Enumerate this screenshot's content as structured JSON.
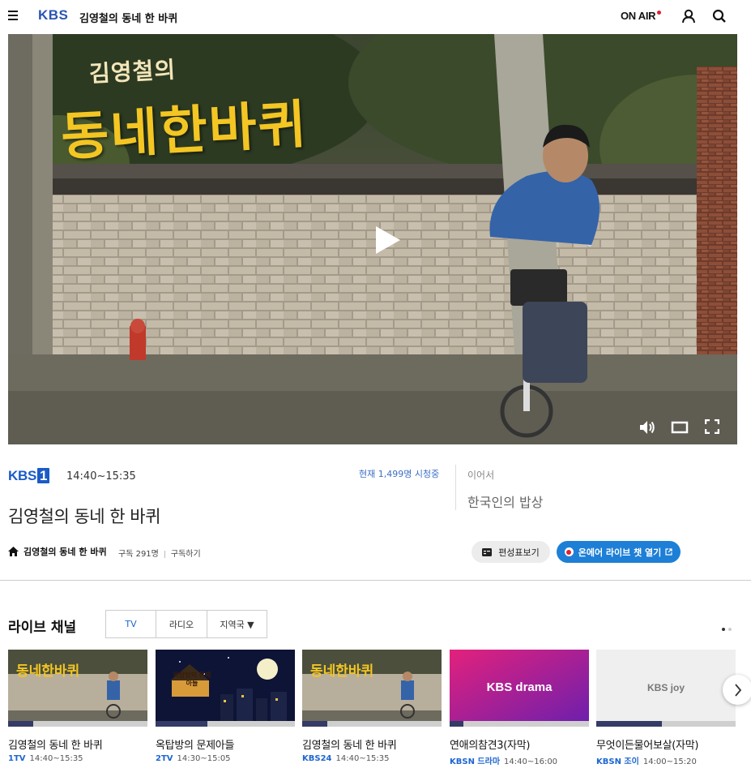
{
  "header": {
    "logo": "KBS",
    "title": "김영철의 동네 한 바퀴",
    "onair": "ON AIR"
  },
  "player": {
    "poster_text_small": "김영철의",
    "poster_text_large": "동네한바퀴"
  },
  "program": {
    "channel_logo": "KBS",
    "channel_logo_num": "1",
    "time": "14:40~15:35",
    "viewers": "현재 1,499명 시청중",
    "next_label": "이어서",
    "next_show": "한국인의 밥상",
    "title": "김영철의 동네 한 바퀴",
    "home_link": "김영철의 동네 한 바퀴",
    "subscribers": "구독 291명",
    "subscribe": "구독하기",
    "schedule_button": "편성표보기",
    "chat_button": "온에어 라이브 챗 열기"
  },
  "live": {
    "heading": "라이브 채널",
    "tabs": [
      "TV",
      "라디오",
      "지역국 ▼"
    ],
    "cards": [
      {
        "title": "김영철의 동네 한 바퀴",
        "channel": "1TV",
        "time": "14:40~15:35",
        "progress": 0.18
      },
      {
        "title": "옥탑방의 문제아들",
        "channel": "2TV",
        "time": "14:30~15:05",
        "progress": 0.37,
        "thumb_text": "옥탑방의 문제아들"
      },
      {
        "title": "김영철의 동네 한 바퀴",
        "channel": "KBS24",
        "time": "14:40~15:35",
        "progress": 0.18
      },
      {
        "title": "연애의참견3(자막)",
        "channel": "KBSN 드라마",
        "time": "14:40~16:00",
        "progress": 0.1,
        "thumb_text": "KBS drama"
      },
      {
        "title": "무엇이든물어보살(자막)",
        "channel": "KBSN 조이",
        "time": "14:00~15:20",
        "progress": 0.47,
        "thumb_text": "KBS joy"
      }
    ]
  },
  "colors": {
    "brand_blue": "#2a55b3",
    "live_red": "#e0212f",
    "chat_button": "#1e7fd6",
    "progress": "#333b66"
  }
}
